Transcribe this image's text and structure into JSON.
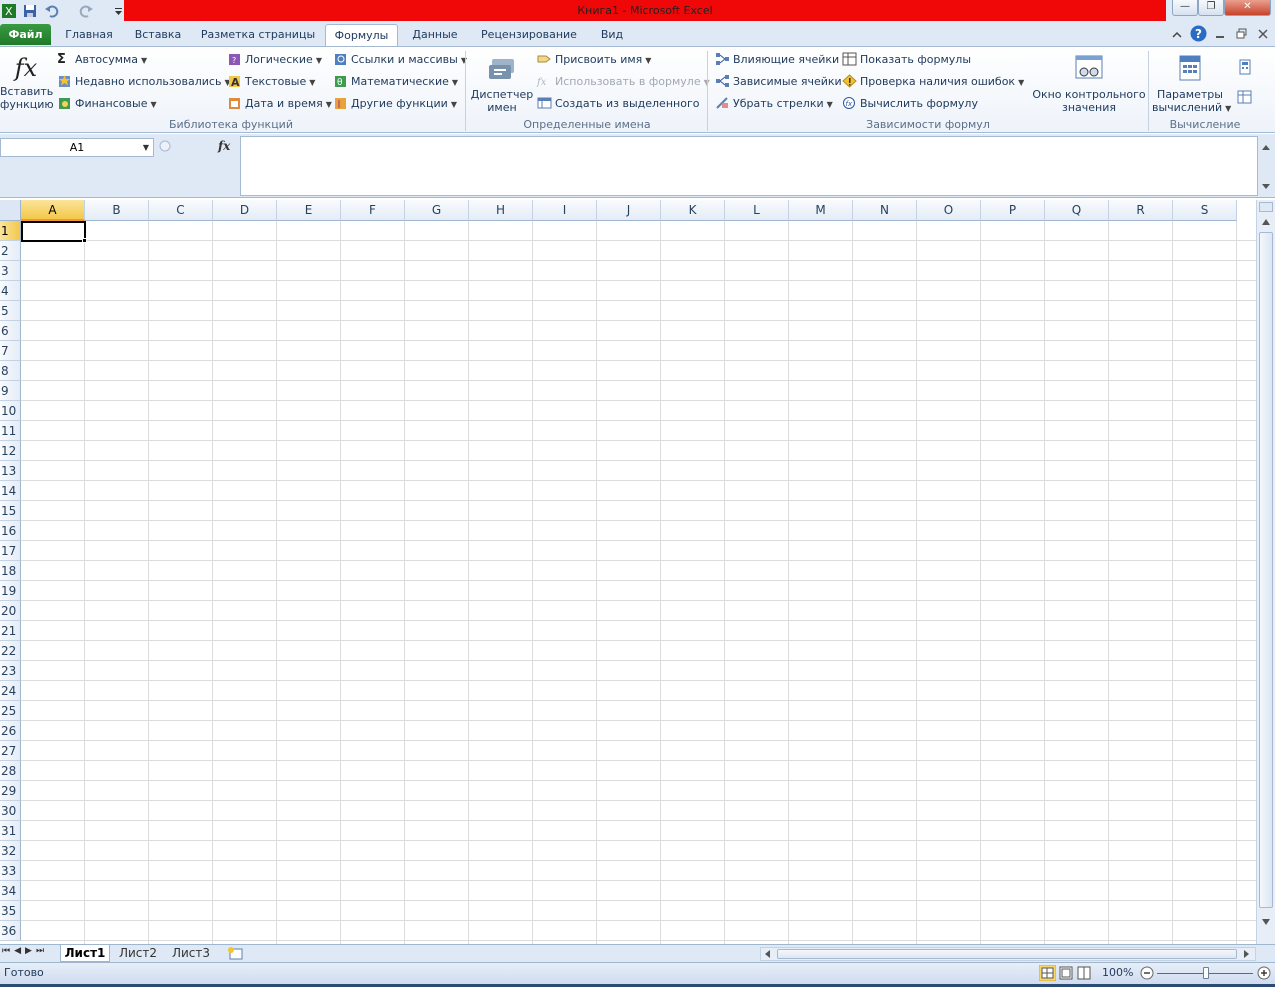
{
  "window": {
    "title": "Книга1  -  Microsoft Excel",
    "minimize": "—",
    "restore": "❐",
    "close": "✕"
  },
  "tabs": {
    "file": "Файл",
    "items": [
      "Главная",
      "Вставка",
      "Разметка страницы",
      "Формулы",
      "Данные",
      "Рецензирование",
      "Вид"
    ],
    "active": "Формулы"
  },
  "ribbon": {
    "library": {
      "label": "Библиотека функций",
      "insert_function": "Вставить функцию",
      "autosum": "Автосумма",
      "recent": "Недавно использовались",
      "financial": "Финансовые",
      "logical": "Логические",
      "text": "Текстовые",
      "datetime": "Дата и время",
      "lookup": "Ссылки и массивы",
      "math": "Математические",
      "more": "Другие функции"
    },
    "names": {
      "label": "Определенные имена",
      "manager_line1": "Диспетчер",
      "manager_line2": "имен",
      "define": "Присвоить имя",
      "use_in_formula": "Использовать в формуле",
      "create_from_selection": "Создать из выделенного"
    },
    "auditing": {
      "label": "Зависимости формул",
      "precedents": "Влияющие ячейки",
      "dependents": "Зависимые ячейки",
      "remove_arrows": "Убрать стрелки",
      "show_formulas": "Показать формулы",
      "error_checking": "Проверка наличия ошибок",
      "evaluate": "Вычислить формулу",
      "watch_line1": "Окно контрольного",
      "watch_line2": "значения"
    },
    "calculation": {
      "label": "Вычисление",
      "options_line1": "Параметры",
      "options_line2": "вычислений"
    }
  },
  "formula_bar": {
    "name_box": "A1",
    "fx": "fx",
    "formula": ""
  },
  "grid": {
    "columns": [
      "A",
      "B",
      "C",
      "D",
      "E",
      "F",
      "G",
      "H",
      "I",
      "J",
      "K",
      "L",
      "M",
      "N",
      "O",
      "P",
      "Q",
      "R",
      "S"
    ],
    "rows": [
      "1",
      "2",
      "3",
      "4",
      "5",
      "6",
      "7",
      "8",
      "9",
      "10",
      "11",
      "12",
      "13",
      "14",
      "15",
      "16",
      "17",
      "18",
      "19",
      "20",
      "21",
      "22",
      "23",
      "24",
      "25",
      "26",
      "27",
      "28",
      "29",
      "30",
      "31",
      "32",
      "33",
      "34",
      "35",
      "36"
    ],
    "active_cell": "A1"
  },
  "sheets": {
    "tabs": [
      "Лист1",
      "Лист2",
      "Лист3"
    ],
    "active": "Лист1"
  },
  "status": {
    "ready": "Готово",
    "zoom": "100%"
  },
  "colors": {
    "title_bar": "#f00808",
    "file_tab": "#2a8a33",
    "selection_header": "#f7d15d"
  }
}
